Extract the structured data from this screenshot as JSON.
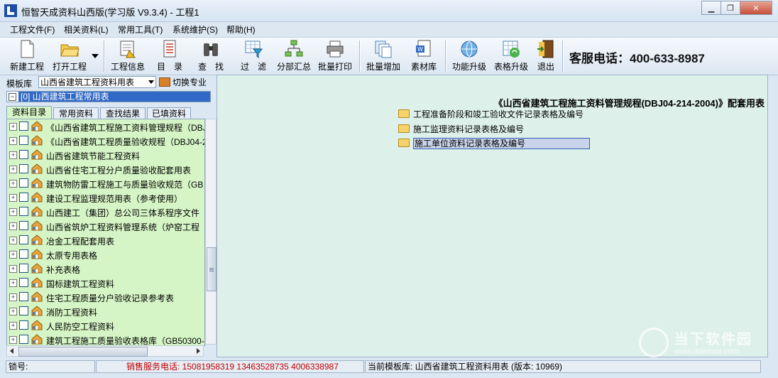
{
  "window": {
    "title": "恒智天成资料山西版(学习版 V9.3.4) - 工程1",
    "controls": [
      "minimize-icon",
      "restore-icon",
      "close-icon"
    ]
  },
  "menu": [
    "工程文件(F)",
    "相关资料(L)",
    "常用工具(T)",
    "系统维护(S)",
    "帮助(H)"
  ],
  "toolbar": {
    "buttons": [
      {
        "label": "新建工程",
        "icon": "new-file-icon"
      },
      {
        "label": "打开工程",
        "icon": "open-folder-icon"
      },
      {
        "label": "工程信息",
        "icon": "project-info-icon"
      },
      {
        "label": "目　录",
        "icon": "directory-icon"
      },
      {
        "label": "查　找",
        "icon": "binoculars-icon"
      },
      {
        "label": "过　滤",
        "icon": "filter-icon"
      },
      {
        "label": "分部汇总",
        "icon": "summary-tree-icon"
      },
      {
        "label": "批量打印",
        "icon": "printer-icon"
      },
      {
        "label": "批量增加",
        "icon": "batch-add-icon"
      },
      {
        "label": "素材库",
        "icon": "material-library-icon"
      },
      {
        "label": "功能升级",
        "icon": "globe-icon"
      },
      {
        "label": "表格升级",
        "icon": "table-upgrade-icon"
      },
      {
        "label": "退出",
        "icon": "exit-door-icon"
      }
    ],
    "phone": "客服电话：400-633-8987"
  },
  "left_panel": {
    "template_label": "模板库",
    "template_value": "山西省建筑工程资料用表",
    "switch_label": "切换专业",
    "project_node": "[0] 山西建筑工程常用表",
    "tabs": [
      "资料目录",
      "常用资料",
      "查找结果",
      "已填资料"
    ],
    "active_tab": "资料目录",
    "tree_items": [
      "《山西省建筑工程施工资料管理规程（DBJ",
      "《山西省建筑工程质量验收规程（DBJ04-2",
      "山西省建筑节能工程资料",
      "山西省住宅工程分户质量验收配套用表",
      "建筑物防雷工程施工与质量验收规范（GB",
      "建设工程监理规范用表（参考使用）",
      "山西建工（集团）总公司三体系程序文件",
      "山西省筑炉工程资料管理系统（炉窑工程",
      "冶金工程配套用表",
      "太原专用表格",
      "补充表格",
      "国标建筑工程资料",
      "住宅工程质量分户验收记录参考表",
      "消防工程资料",
      "人民防空工程资料",
      "建筑工程施工质量验收表格库（GB50300-"
    ]
  },
  "right_panel": {
    "title": "《山西省建筑工程施工资料管理规程(DBJ04-214-2004)》配套用表",
    "items": [
      "工程准备阶段和竣工验收文件记录表格及编号",
      "施工监理资料记录表格及编号",
      "施工单位资料记录表格及编号"
    ],
    "selected_item": "施工单位资料记录表格及编号"
  },
  "watermark": {
    "text": "当下软件园",
    "url": "www.downxia.com"
  },
  "status_bar": {
    "lock": "锁号:",
    "sales": "销售服务电话: 15081958319 13463528735 4006338987",
    "current_template": "当前模板库: 山西省建筑工程资料用表 (版本: 10969)"
  }
}
